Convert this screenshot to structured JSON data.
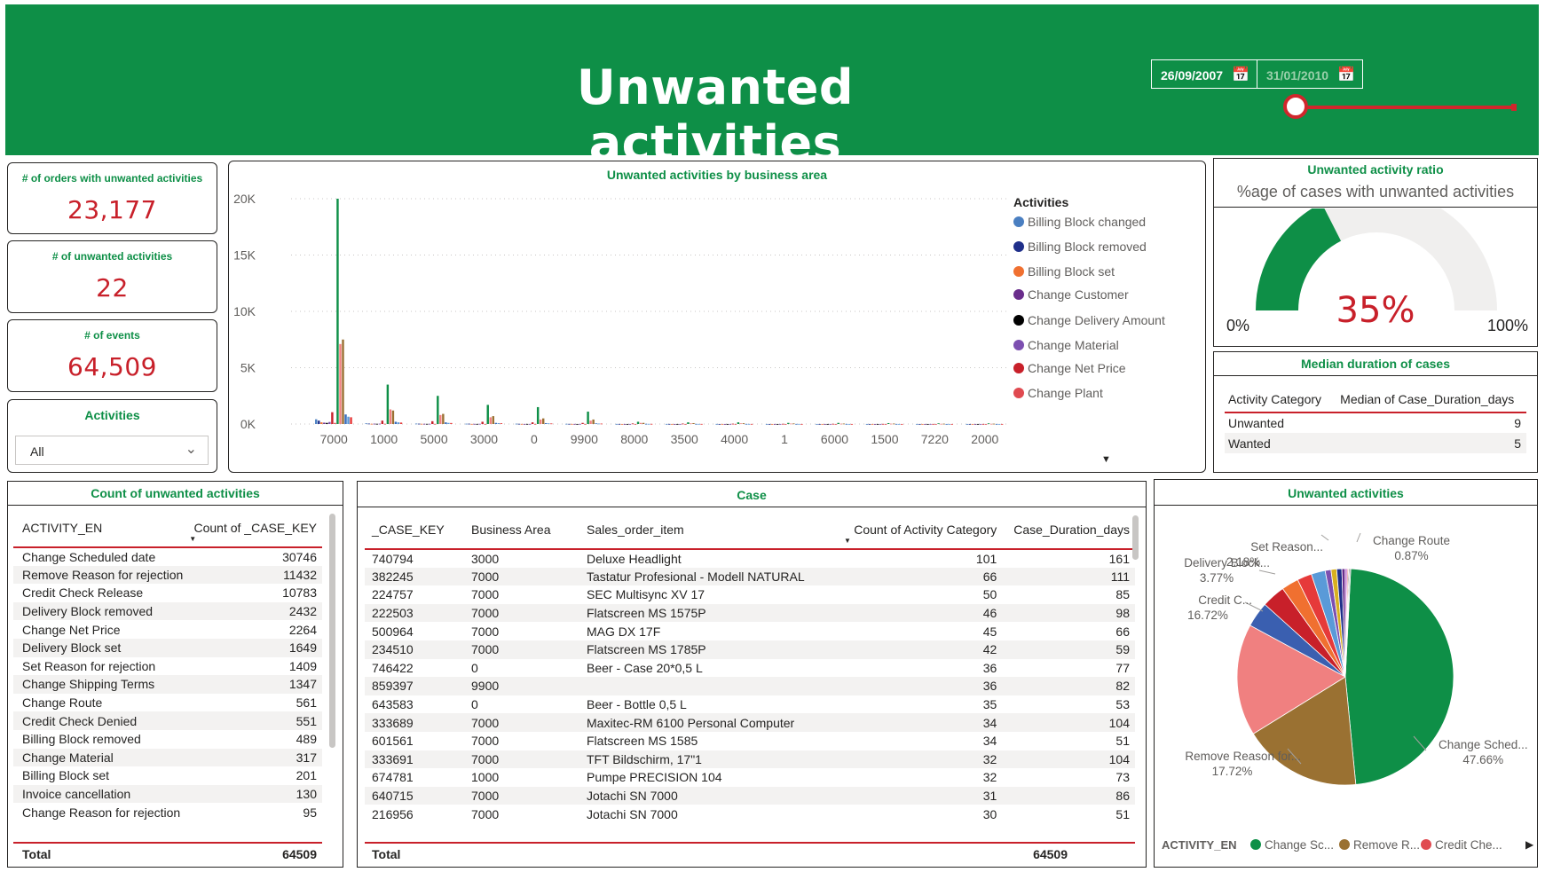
{
  "header": {
    "title": "Unwanted activities",
    "start_date": "26/09/2007",
    "end_date": "31/01/2010"
  },
  "colors": {
    "brand_green": "#0e8f47",
    "accent_red": "#c8202a"
  },
  "kpis": [
    {
      "label": "# of orders with unwanted activities",
      "value": "23,177"
    },
    {
      "label": "# of unwanted activities",
      "value": "22"
    },
    {
      "label": "# of events",
      "value": "64,509"
    }
  ],
  "activities_slicer": {
    "title": "Activities",
    "selected": "All"
  },
  "business_area_chart": {
    "title": "Unwanted activities by business area",
    "legend_title": "Activities",
    "legend": [
      {
        "name": "Billing Block changed",
        "color": "#4a7fc1"
      },
      {
        "name": "Billing Block removed",
        "color": "#1f2f8a"
      },
      {
        "name": "Billing Block set",
        "color": "#f07030"
      },
      {
        "name": "Change Customer",
        "color": "#6a2d8c"
      },
      {
        "name": "Change Delivery Amount",
        "color": "#000000"
      },
      {
        "name": "Change Material",
        "color": "#7c4fb0"
      },
      {
        "name": "Change Net Price",
        "color": "#c8202a"
      },
      {
        "name": "Change Plant",
        "color": "#e04a50"
      }
    ],
    "y_ticks": [
      "20K",
      "15K",
      "10K",
      "5K",
      "0K"
    ]
  },
  "chart_data": {
    "type": "bar",
    "categories": [
      "7000",
      "1000",
      "5000",
      "3000",
      "0",
      "9900",
      "8000",
      "3500",
      "4000",
      "1",
      "6000",
      "1500",
      "7220",
      "2000"
    ],
    "ylim": [
      0,
      20000
    ],
    "series": [
      {
        "name": "Billing Block changed",
        "color": "#4a7fc1",
        "values": [
          420,
          60,
          40,
          30,
          30,
          20,
          10,
          10,
          10,
          5,
          5,
          5,
          5,
          5
        ]
      },
      {
        "name": "Billing Block removed",
        "color": "#1f2f8a",
        "values": [
          300,
          40,
          30,
          30,
          20,
          15,
          10,
          10,
          5,
          5,
          5,
          5,
          5,
          5
        ]
      },
      {
        "name": "Billing Block set",
        "color": "#f07030",
        "values": [
          150,
          20,
          20,
          10,
          10,
          10,
          5,
          5,
          5,
          5,
          5,
          5,
          5,
          5
        ]
      },
      {
        "name": "Change Customer",
        "color": "#6a2d8c",
        "values": [
          120,
          30,
          20,
          15,
          10,
          10,
          5,
          5,
          5,
          5,
          5,
          5,
          5,
          5
        ]
      },
      {
        "name": "Change Delivery Amount",
        "color": "#000000",
        "values": [
          100,
          20,
          15,
          10,
          10,
          5,
          5,
          5,
          5,
          5,
          5,
          5,
          5,
          5
        ]
      },
      {
        "name": "Change Material",
        "color": "#7c4fb0",
        "values": [
          180,
          30,
          20,
          20,
          10,
          10,
          5,
          5,
          5,
          5,
          5,
          5,
          5,
          5
        ]
      },
      {
        "name": "Change Net Price",
        "color": "#c8202a",
        "values": [
          1050,
          300,
          250,
          200,
          150,
          100,
          50,
          40,
          30,
          20,
          20,
          15,
          10,
          10
        ]
      },
      {
        "name": "Change Plant",
        "color": "#e04a50",
        "values": [
          100,
          20,
          15,
          10,
          10,
          10,
          5,
          5,
          5,
          5,
          5,
          5,
          5,
          5
        ]
      },
      {
        "name": "Change Scheduled date",
        "color": "#0e8f47",
        "values": [
          20000,
          3500,
          2500,
          1700,
          1500,
          1100,
          200,
          150,
          150,
          100,
          100,
          80,
          60,
          60
        ]
      },
      {
        "name": "Credit Check Release",
        "color": "#f28080",
        "values": [
          7100,
          1300,
          800,
          600,
          400,
          300,
          100,
          60,
          60,
          40,
          30,
          30,
          20,
          20
        ]
      },
      {
        "name": "Remove Reason for rejection",
        "color": "#9a7132",
        "values": [
          7500,
          1200,
          900,
          700,
          500,
          400,
          100,
          80,
          70,
          50,
          40,
          40,
          30,
          30
        ]
      },
      {
        "name": "Delivery Block removed",
        "color": "#3a6fbf",
        "values": [
          850,
          200,
          150,
          100,
          80,
          60,
          20,
          15,
          15,
          10,
          10,
          10,
          5,
          5
        ]
      },
      {
        "name": "Delivery Block set",
        "color": "#5a9ad8",
        "values": [
          650,
          150,
          100,
          80,
          60,
          40,
          15,
          10,
          10,
          10,
          5,
          5,
          5,
          5
        ]
      },
      {
        "name": "Set Reason for rejection",
        "color": "#e63a3a",
        "values": [
          600,
          130,
          90,
          70,
          50,
          40,
          15,
          10,
          10,
          5,
          5,
          5,
          5,
          5
        ]
      }
    ]
  },
  "ratio_panel": {
    "title": "Unwanted activity ratio",
    "subtitle": "%age of cases with unwanted activities",
    "value": "35%",
    "fraction": 0.35,
    "min_label": "0%",
    "max_label": "100%"
  },
  "median_panel": {
    "title": "Median duration of cases",
    "col1": "Activity Category",
    "col2": "Median of Case_Duration_days",
    "rows": [
      {
        "category": "Unwanted",
        "value": "9"
      },
      {
        "category": "Wanted",
        "value": "5"
      }
    ]
  },
  "count_panel": {
    "title": "Count of unwanted activities",
    "col1": "ACTIVITY_EN",
    "col2": "Count of _CASE_KEY",
    "rows": [
      [
        "Change Scheduled date",
        "30746"
      ],
      [
        "Remove Reason for rejection",
        "11432"
      ],
      [
        "Credit Check Release",
        "10783"
      ],
      [
        "Delivery Block removed",
        "2432"
      ],
      [
        "Change Net Price",
        "2264"
      ],
      [
        "Delivery Block set",
        "1649"
      ],
      [
        "Set Reason for rejection",
        "1409"
      ],
      [
        "Change Shipping Terms",
        "1347"
      ],
      [
        "Change Route",
        "561"
      ],
      [
        "Credit Check Denied",
        "551"
      ],
      [
        "Billing Block removed",
        "489"
      ],
      [
        "Change Material",
        "317"
      ],
      [
        "Billing Block set",
        "201"
      ],
      [
        "Invoice cancellation",
        "130"
      ],
      [
        "Change Reason for rejection",
        "95"
      ]
    ],
    "total_label": "Total",
    "total_value": "64509"
  },
  "case_panel": {
    "title": "Case",
    "columns": [
      "_CASE_KEY",
      "Business Area",
      "Sales_order_item",
      "Count of Activity Category",
      "Case_Duration_days"
    ],
    "rows": [
      [
        "740794",
        "3000",
        "Deluxe Headlight",
        "101",
        "161"
      ],
      [
        "382245",
        "7000",
        "Tastatur Profesional - Modell NATURAL",
        "66",
        "111"
      ],
      [
        "224757",
        "7000",
        "SEC Multisync XV 17",
        "50",
        "85"
      ],
      [
        "222503",
        "7000",
        "Flatscreen MS 1575P",
        "46",
        "98"
      ],
      [
        "500964",
        "7000",
        "MAG DX 17F",
        "45",
        "66"
      ],
      [
        "234510",
        "7000",
        "Flatscreen MS 1785P",
        "42",
        "59"
      ],
      [
        "746422",
        "0",
        "Beer - Case 20*0,5 L",
        "36",
        "77"
      ],
      [
        "859397",
        "9900",
        "",
        "36",
        "82"
      ],
      [
        "643583",
        "0",
        "Beer - Bottle 0,5 L",
        "35",
        "53"
      ],
      [
        "333689",
        "7000",
        "Maxitec-RM 6100 Personal Computer",
        "34",
        "104"
      ],
      [
        "601561",
        "7000",
        "Flatscreen MS 1585",
        "34",
        "51"
      ],
      [
        "333691",
        "7000",
        "TFT Bildschirm, 17\"1",
        "32",
        "104"
      ],
      [
        "674781",
        "1000",
        "Pumpe PRECISION 104",
        "32",
        "73"
      ],
      [
        "640715",
        "7000",
        "Jotachi SN 7000",
        "31",
        "86"
      ],
      [
        "216956",
        "7000",
        "Jotachi SN 7000",
        "30",
        "51"
      ]
    ],
    "total_label": "Total",
    "total_value": "64509"
  },
  "pie_panel": {
    "title": "Unwanted activities",
    "legend_title": "ACTIVITY_EN",
    "legend": [
      {
        "label": "Change Sc...",
        "color": "#0e8f47"
      },
      {
        "label": "Remove R...",
        "color": "#9a7132"
      },
      {
        "label": "Credit Che...",
        "color": "#e04a50"
      }
    ],
    "labels": [
      {
        "name": "Change Sched...",
        "pct": "47.66%"
      },
      {
        "name": "Remove Reason for...",
        "pct": "17.72%"
      },
      {
        "name": "Credit C...",
        "pct": "16.72%"
      },
      {
        "name": "Delivery Block...",
        "pct": "3.77%"
      },
      {
        "name": "Set Reason...",
        "pct": "2.18%"
      },
      {
        "name": "Change Route",
        "pct": "0.87%"
      }
    ],
    "slices": [
      {
        "value": 47.66,
        "color": "#0e8f47"
      },
      {
        "value": 17.72,
        "color": "#9a7132"
      },
      {
        "value": 16.72,
        "color": "#f08080"
      },
      {
        "value": 3.77,
        "color": "#3a5fb0"
      },
      {
        "value": 3.51,
        "color": "#c8202a"
      },
      {
        "value": 2.56,
        "color": "#f07030"
      },
      {
        "value": 2.18,
        "color": "#e63a3a"
      },
      {
        "value": 2.09,
        "color": "#5a9ad8"
      },
      {
        "value": 0.87,
        "color": "#7c4fb0"
      },
      {
        "value": 0.85,
        "color": "#d8b020"
      },
      {
        "value": 0.76,
        "color": "#1f2f8a"
      },
      {
        "value": 0.49,
        "color": "#6a2d8c"
      },
      {
        "value": 0.31,
        "color": "#c06ad0"
      },
      {
        "value": 0.2,
        "color": "#e08080"
      },
      {
        "value": 0.15,
        "color": "#000000"
      },
      {
        "value": 0.16,
        "color": "#888888"
      }
    ]
  }
}
